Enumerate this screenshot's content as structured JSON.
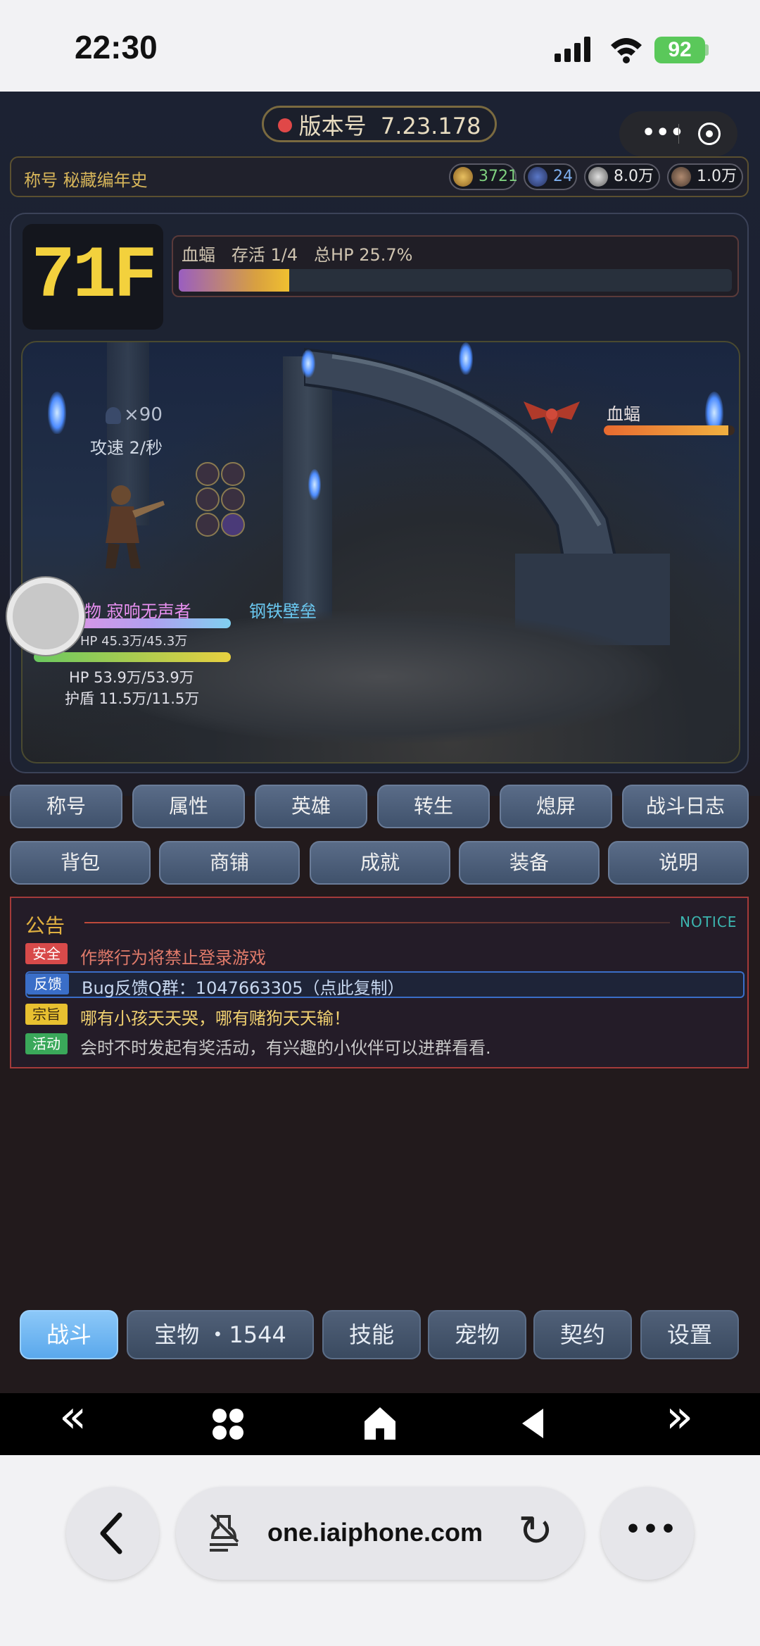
{
  "status": {
    "time": "22:30",
    "battery": "92"
  },
  "game": {
    "version_label": "版本号",
    "version": "7.23.178",
    "title_label": "称号 秘藏编年史",
    "resources": [
      {
        "value": "3721",
        "color": "#7fd07f"
      },
      {
        "value": "24",
        "color": "#7fb0f0"
      },
      {
        "value": "8.0万",
        "color": "#e8e8e8"
      },
      {
        "value": "1.0万",
        "color": "#e8e8e8"
      }
    ],
    "floor": "71F",
    "enemy": {
      "name": "血蝠",
      "survive": "存活 1/4",
      "total_hp": "总HP 25.7%",
      "total_hp_fraction": 0.2
    },
    "scene": {
      "hero_count": "×90",
      "attack_speed": "攻速 2/秒",
      "enemy_label": "血蝠",
      "enemy_hp_fraction": 0.95,
      "pet_label": "宠物 寂响无声者",
      "pet_title": "钢铁壁垒",
      "pet_hp": "HP 45.3万/45.3万",
      "pet_hp_fraction": 1.0,
      "hero_hp": "HP 53.9万/53.9万",
      "hero_hp_fraction": 1.0,
      "hero_shield": "护盾 11.5万/11.5万"
    },
    "menu_row1": [
      "称号",
      "属性",
      "英雄",
      "转生",
      "熄屏",
      "战斗日志"
    ],
    "menu_row2": [
      "背包",
      "商铺",
      "成就",
      "装备",
      "说明"
    ],
    "notice": {
      "title": "公告",
      "tag": "NOTICE",
      "items": [
        {
          "badge": "安全",
          "text": "作弊行为将禁止登录游戏",
          "badge_color": "#d84a4a",
          "text_color": "#e07a6a"
        },
        {
          "badge": "反馈",
          "text": "Bug反馈Q群：1047663305（点此复制）",
          "badge_color": "#3a6ec8",
          "text_color": "#c8d8f0"
        },
        {
          "badge": "宗旨",
          "text": "哪有小孩天天哭，哪有赌狗天天输！",
          "badge_color": "#e8c030",
          "text_color": "#f0d070"
        },
        {
          "badge": "活动",
          "text": "会时不时发起有奖活动，有兴趣的小伙伴可以进群看看.",
          "badge_color": "#3aa85a",
          "text_color": "#c8c8c8"
        }
      ]
    },
    "tabs": [
      "战斗",
      "宝物 ・1544",
      "技能",
      "宠物",
      "契约",
      "设置"
    ]
  },
  "nav": {
    "first": "«",
    "apps": "✥",
    "home": "⌂",
    "prev": "◀",
    "last": "»"
  },
  "browser": {
    "url": "one.iaiphone.com",
    "back": "‹",
    "more": "•••",
    "reload": "↻"
  }
}
